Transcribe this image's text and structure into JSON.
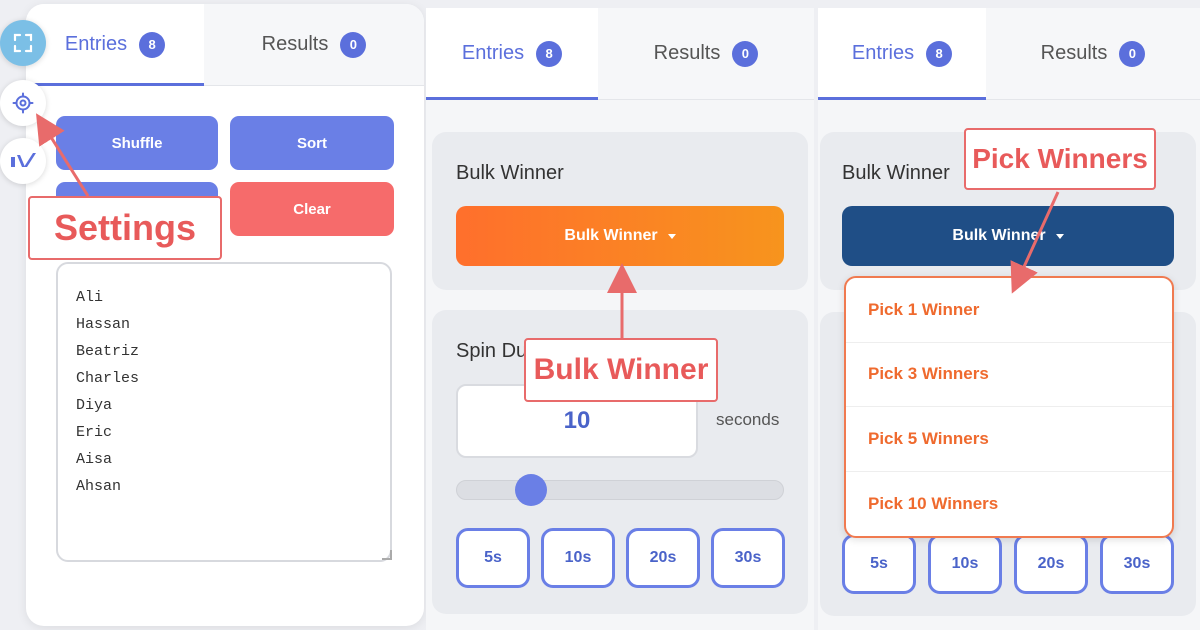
{
  "tabs": {
    "entries_label": "Entries",
    "entries_count": "8",
    "results_label": "Results",
    "results_count": "0"
  },
  "panel1": {
    "shuffle_label": "Shuffle",
    "sort_label": "Sort",
    "clear_label": "Clear",
    "entries_text": "Ali\nHassan\nBeatriz\nCharles\nDiya\nEric\nAisa\nAhsan"
  },
  "panel2": {
    "bulk_winner_heading": "Bulk Winner",
    "bulk_winner_button": "Bulk Winner",
    "spin_duration_heading": "Spin Du",
    "duration_value": "10",
    "seconds_label": "seconds",
    "slider_fraction": 0.2,
    "presets": [
      "5s",
      "10s",
      "20s",
      "30s"
    ]
  },
  "panel3": {
    "bulk_winner_heading": "Bulk Winner",
    "bulk_winner_button": "Bulk Winner",
    "dropdown_items": [
      "Pick 1 Winner",
      "Pick 3 Winners",
      "Pick 5 Winners",
      "Pick 10 Winners"
    ],
    "presets": [
      "5s",
      "10s",
      "20s",
      "30s"
    ]
  },
  "callouts": {
    "settings": "Settings",
    "bulk_winner": "Bulk Winner",
    "pick_winners": "Pick Winners"
  },
  "colors": {
    "accent": "#5b6fdc",
    "orange_gradient_start": "#ff6f2c",
    "orange_gradient_end": "#f7941d",
    "navy_button": "#1f4e86",
    "callout_red": "#e86b6b"
  },
  "icons": {
    "fullscreen": "fullscreen-icon",
    "settings": "gear-icon",
    "logo": "app-logo-icon"
  }
}
